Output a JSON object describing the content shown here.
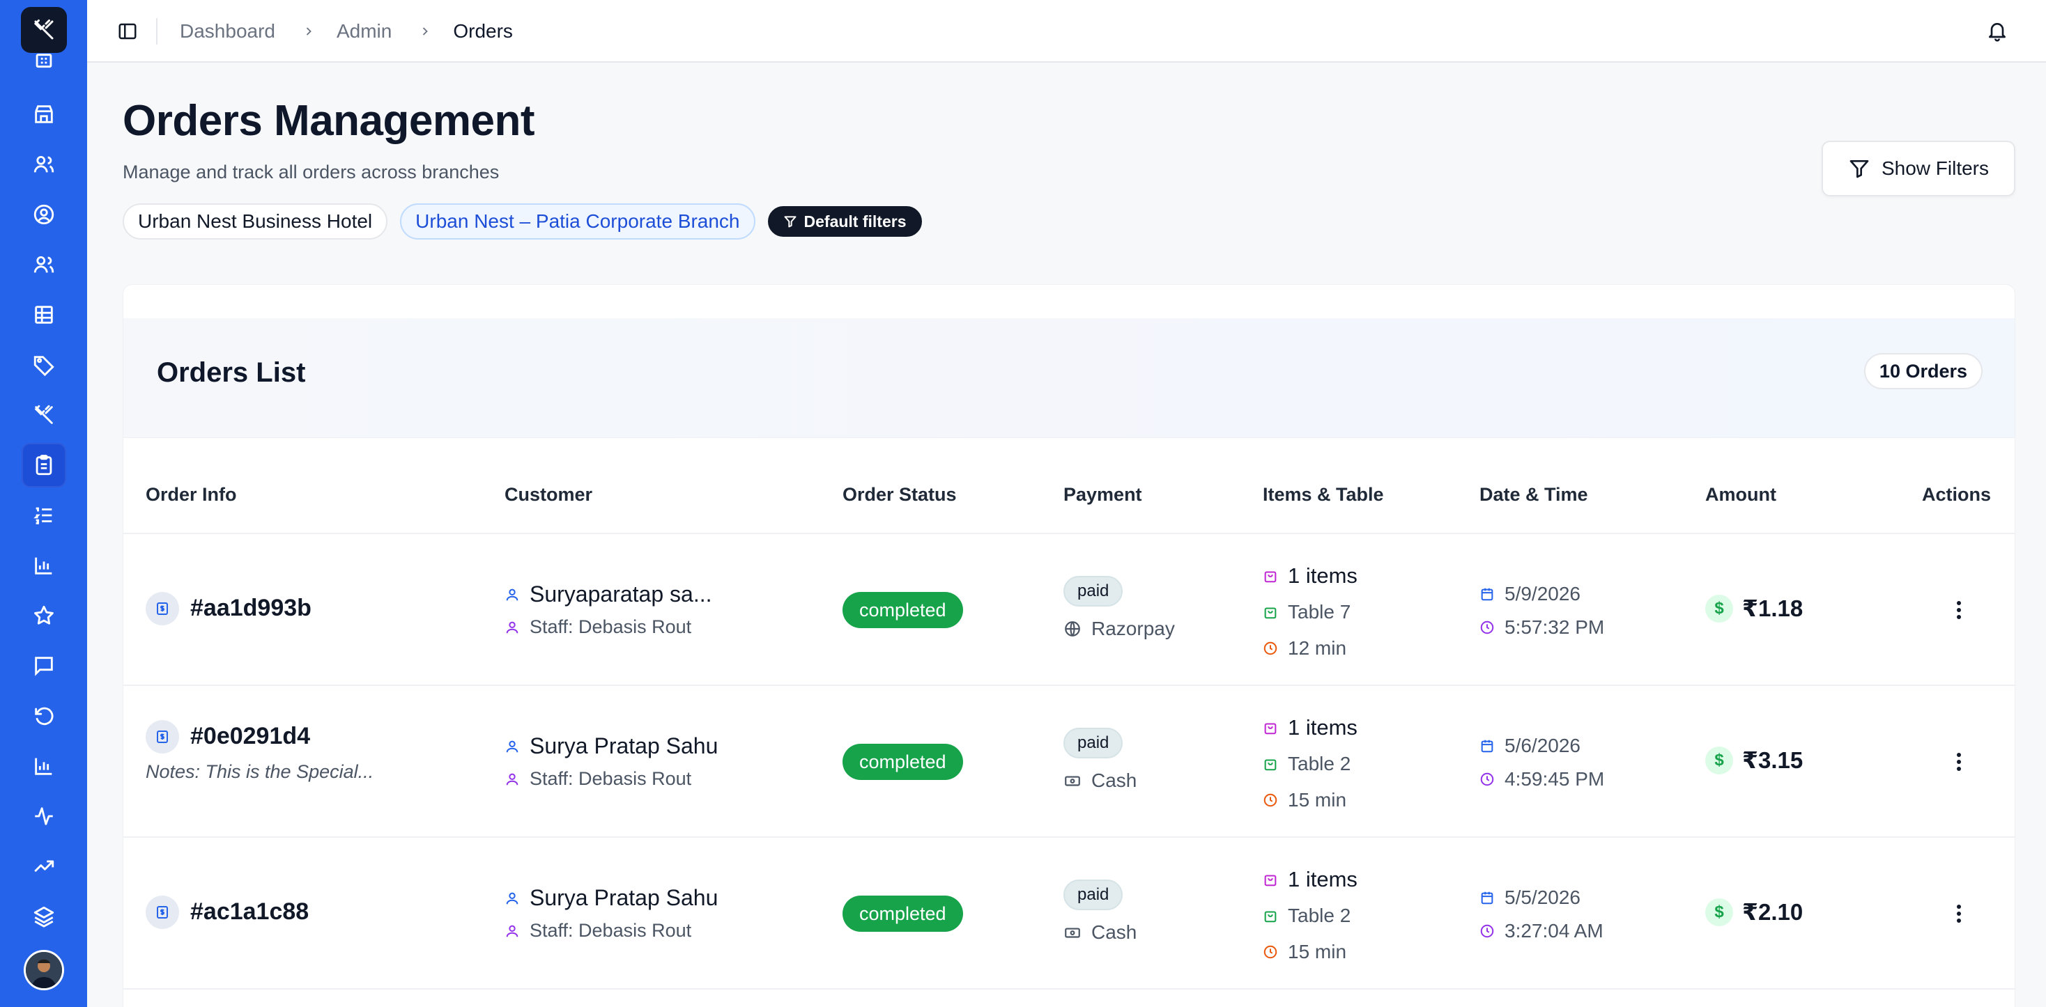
{
  "breadcrumb": {
    "items": [
      "Dashboard",
      "Admin",
      "Orders"
    ]
  },
  "header": {
    "title": "Orders Management",
    "subtitle": "Manage and track all orders across branches",
    "chips": [
      "Urban Nest Business Hotel",
      "Urban Nest – Patia Corporate Branch"
    ],
    "default_filters": "Default filters",
    "show_filters": "Show Filters"
  },
  "orders_card": {
    "title": "Orders List",
    "count": "10 Orders",
    "columns": [
      "Order Info",
      "Customer",
      "Order Status",
      "Payment",
      "Items & Table",
      "Date & Time",
      "Amount",
      "Actions"
    ]
  },
  "orders": [
    {
      "id": "#aa1d993b",
      "notes": "",
      "customer": "Suryaparatap sa...",
      "staff": "Staff: Debasis Rout",
      "status": "completed",
      "payment_status": "paid",
      "payment_method": "Razorpay",
      "payment_icon": "globe-icon",
      "items": "1 items",
      "table": "Table 7",
      "duration": "12 min",
      "date": "5/9/2026",
      "time": "5:57:32 PM",
      "amount": "₹1.18"
    },
    {
      "id": "#0e0291d4",
      "notes": "Notes: This is the Special...",
      "customer": "Surya Pratap Sahu",
      "staff": "Staff: Debasis Rout",
      "status": "completed",
      "payment_status": "paid",
      "payment_method": "Cash",
      "payment_icon": "banknote-icon",
      "items": "1 items",
      "table": "Table 2",
      "duration": "15 min",
      "date": "5/6/2026",
      "time": "4:59:45 PM",
      "amount": "₹3.15"
    },
    {
      "id": "#ac1a1c88",
      "notes": "",
      "customer": "Surya Pratap Sahu",
      "staff": "Staff: Debasis Rout",
      "status": "completed",
      "payment_status": "paid",
      "payment_method": "Cash",
      "payment_icon": "banknote-icon",
      "items": "1 items",
      "table": "Table 2",
      "duration": "15 min",
      "date": "5/5/2026",
      "time": "3:27:04 AM",
      "amount": "₹2.10"
    }
  ],
  "sidebar": {
    "icons": [
      "building-icon",
      "store-icon",
      "users-icon",
      "user-circle-icon",
      "staff-icon",
      "table-icon",
      "tag-icon",
      "utensils-icon",
      "clipboard-icon",
      "list-ordered-icon",
      "bar-chart-icon",
      "star-icon",
      "message-icon",
      "refresh-icon",
      "bar-chart-2-icon",
      "activity-icon",
      "trending-up-icon",
      "layers-icon"
    ],
    "active": "clipboard-icon"
  },
  "colors": {
    "sidebar": "#2563eb",
    "status_completed": "#16a34a",
    "accent_blue": "#1d4ed8"
  }
}
